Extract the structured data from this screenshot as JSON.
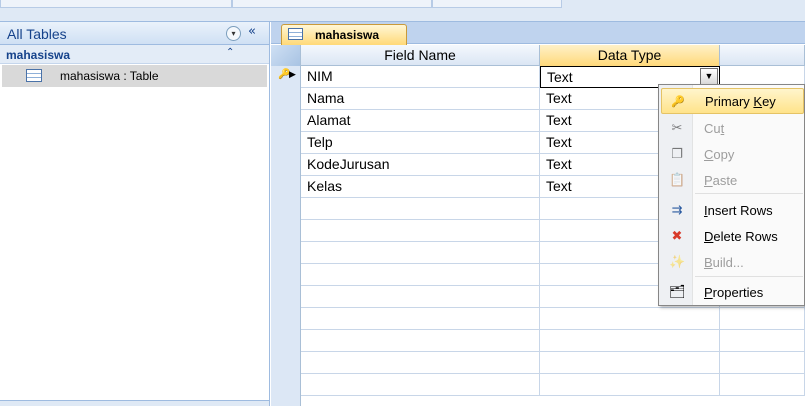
{
  "nav": {
    "header_title": "All Tables",
    "dropdown_glyph": "▾",
    "shutter_glyph": "«",
    "group": {
      "label": "mahasiswa",
      "collapse_glyph": "⌃"
    },
    "items": [
      {
        "label": "mahasiswa : Table"
      }
    ]
  },
  "document": {
    "tab_label": "mahasiswa",
    "columns": {
      "field_name": "Field Name",
      "data_type": "Data Type",
      "description": ""
    },
    "dropdown_glyph": "▼",
    "rows": [
      {
        "field": "NIM",
        "type": "Text",
        "primary_key": true
      },
      {
        "field": "Nama",
        "type": "Text"
      },
      {
        "field": "Alamat",
        "type": "Text"
      },
      {
        "field": "Telp",
        "type": "Text"
      },
      {
        "field": "KodeJurusan",
        "type": "Text"
      },
      {
        "field": "Kelas",
        "type": "Text"
      },
      {
        "field": "",
        "type": ""
      },
      {
        "field": "",
        "type": ""
      },
      {
        "field": "",
        "type": ""
      },
      {
        "field": "",
        "type": ""
      },
      {
        "field": "",
        "type": ""
      },
      {
        "field": "",
        "type": ""
      },
      {
        "field": "",
        "type": ""
      },
      {
        "field": "",
        "type": ""
      },
      {
        "field": "",
        "type": ""
      }
    ]
  },
  "context_menu": {
    "items": [
      {
        "label_pre": "Primary ",
        "label_ul": "K",
        "label_post": "ey",
        "icon": "key-icon",
        "state": "hover"
      },
      {
        "label_pre": "Cu",
        "label_ul": "t",
        "label_post": "",
        "icon": "scissors-icon",
        "state": "disabled"
      },
      {
        "label_pre": "",
        "label_ul": "C",
        "label_post": "opy",
        "icon": "copy-icon",
        "state": "disabled"
      },
      {
        "label_pre": "",
        "label_ul": "P",
        "label_post": "aste",
        "icon": "paste-icon",
        "state": "disabled"
      },
      {
        "label_pre": "",
        "label_ul": "I",
        "label_post": "nsert Rows",
        "icon": "insert-rows-icon",
        "state": "enabled"
      },
      {
        "label_pre": "",
        "label_ul": "D",
        "label_post": "elete Rows",
        "icon": "delete-rows-icon",
        "state": "enabled"
      },
      {
        "label_pre": "",
        "label_ul": "B",
        "label_post": "uild...",
        "icon": "build-wand-icon",
        "state": "disabled"
      },
      {
        "label_pre": "",
        "label_ul": "P",
        "label_post": "roperties",
        "icon": "properties-icon",
        "state": "enabled"
      }
    ]
  },
  "colors": {
    "accent_blue": "#15428b",
    "highlight_orange": "#ffd978",
    "pane_border": "#9ebbe0"
  }
}
